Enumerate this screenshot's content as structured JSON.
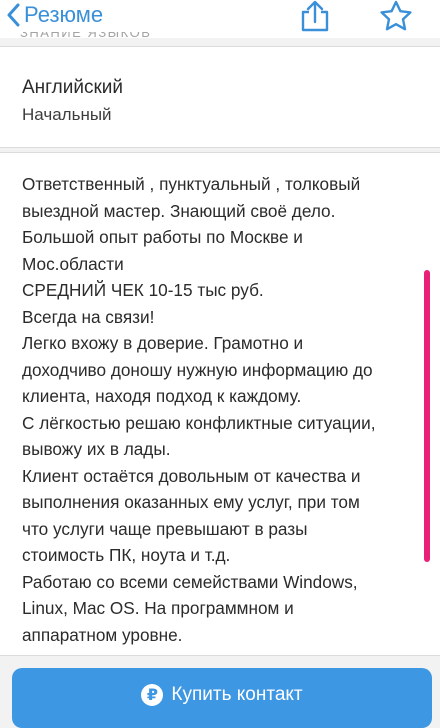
{
  "nav": {
    "back_label": "Резюме",
    "back_icon": "chevron-left-icon",
    "share_icon": "share-icon",
    "favorite_icon": "star-icon",
    "accent_color": "#3a8fd9"
  },
  "section": {
    "cut_header": "ЗНАНИЕ ЯЗЫКОВ"
  },
  "language": {
    "name": "Английский",
    "level": "Начальный"
  },
  "about": {
    "lines": [
      "Ответственный , пунктуальный , толковый",
      "выездной мастер. Знающий своё дело.",
      "Большой опыт работы по Москве и",
      "Мос.области",
      "СРЕДНИЙ ЧЕК 10-15 тыс руб.",
      "Всегда на связи!",
      "Легко вхожу в доверие.  Грамотно и",
      "доходчиво доношу нужную информацию до",
      "клиента, находя подход к каждому.",
      "С лёгкостью решаю конфликтные ситуации,",
      "вывожу их в лады.",
      "Клиент остаётся довольным от качества и",
      "выполнения оказанных ему услуг, при том",
      "что  услуги чаще превышают в разы",
      "стоимость ПК, ноута и т.д.",
      "Работаю со всеми семействами Windows,",
      "Linux, Mac OS.   На программном и",
      "аппаратном уровне."
    ],
    "highlight_color": "#e8207a"
  },
  "buy_button": {
    "label": "Купить контакт",
    "icon": "ruble-icon",
    "icon_glyph": "₽",
    "color": "#3d97e3"
  }
}
